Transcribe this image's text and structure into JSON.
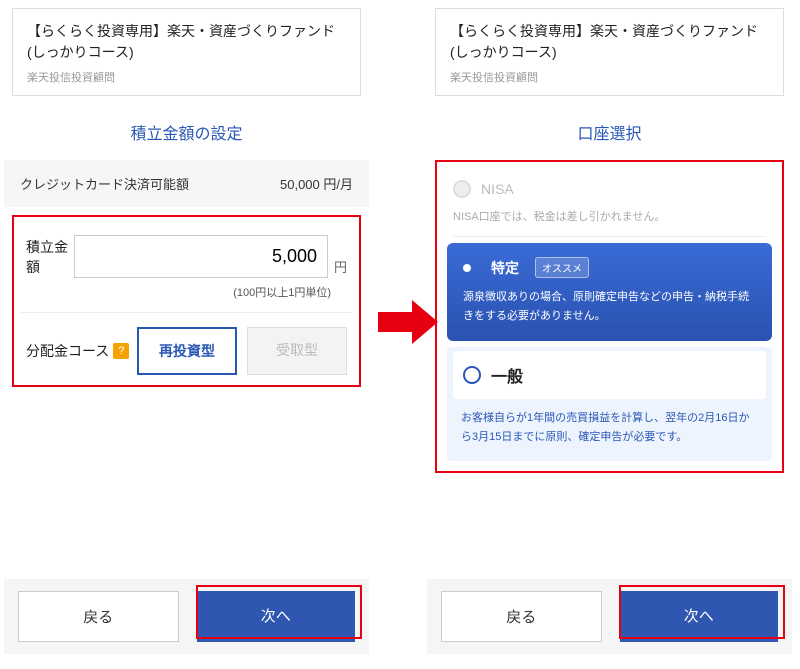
{
  "fund": {
    "name": "【らくらく投資専用】楽天・資産づくりファンド(しっかりコース)",
    "provider": "楽天投信投資顧問"
  },
  "left": {
    "section_title": "積立金額の設定",
    "credit_label": "クレジットカード決済可能額",
    "credit_value": "50,000 円/月",
    "amount_label": "積立金額",
    "amount_value": "5,000",
    "amount_unit": "円",
    "amount_hint": "(100円以上1円単位)",
    "dist_label": "分配金コース",
    "dist_help": "?",
    "dist_reinvest": "再投資型",
    "dist_receive": "受取型"
  },
  "right": {
    "section_title": "口座選択",
    "nisa_label": "NISA",
    "nisa_note": "NISA口座では、税金は差し引かれません。",
    "tokutei_label": "特定",
    "tokutei_badge": "オススメ",
    "tokutei_note": "源泉徴収ありの場合、原則確定申告などの申告・納税手続きをする必要がありません。",
    "ippan_label": "一般",
    "ippan_note": "お客様自らが1年間の売買損益を計算し、翌年の2月16日から3月15日までに原則、確定申告が必要です。"
  },
  "footer": {
    "back": "戻る",
    "next": "次へ"
  }
}
